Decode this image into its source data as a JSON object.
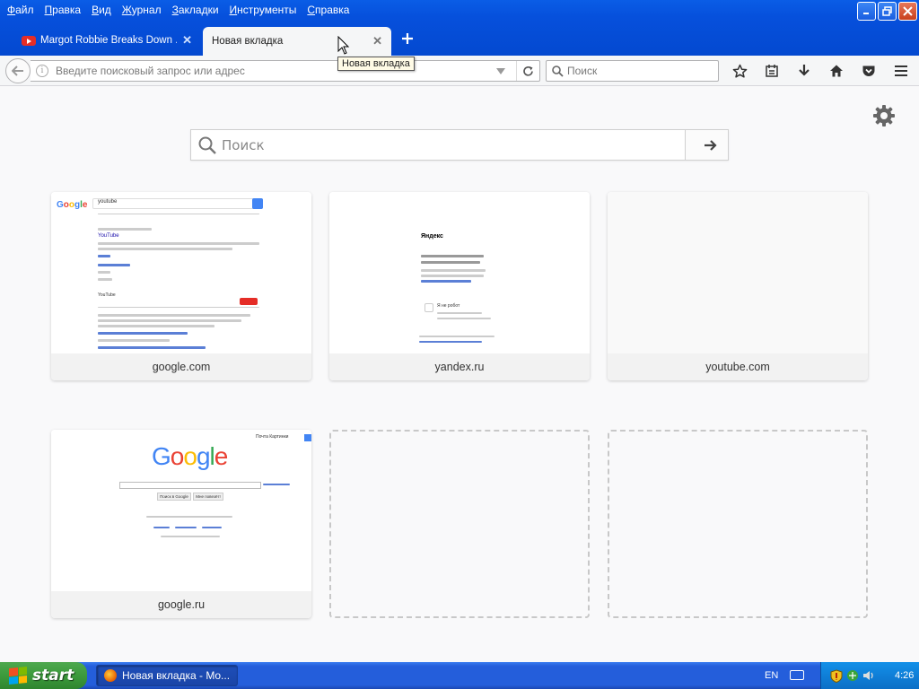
{
  "menu": {
    "items": [
      "Файл",
      "Правка",
      "Вид",
      "Журнал",
      "Закладки",
      "Инструменты",
      "Справка"
    ]
  },
  "window_controls": {
    "minimize": "minimize-icon",
    "maximize": "restore-icon",
    "close": "close-icon"
  },
  "tabs": [
    {
      "label": "Margot Robbie Breaks Down ...",
      "icon": "youtube-icon",
      "active": false
    },
    {
      "label": "Новая вкладка",
      "icon": "",
      "active": true
    }
  ],
  "tooltip": "Новая вкладка",
  "urlbar": {
    "placeholder": "Введите поисковый запрос или адрес"
  },
  "searchbar": {
    "placeholder": "Поиск"
  },
  "page_search": {
    "placeholder": "Поиск"
  },
  "tiles": [
    {
      "label": "google.com",
      "thumb": "google-results"
    },
    {
      "label": "yandex.ru",
      "thumb": "yandex-captcha"
    },
    {
      "label": "youtube.com",
      "thumb": "blank"
    },
    {
      "label": "google.ru",
      "thumb": "google-home"
    },
    {
      "label": "",
      "thumb": "empty"
    },
    {
      "label": "",
      "thumb": "empty"
    }
  ],
  "thumbs": {
    "google_results": {
      "query": "youtube",
      "result_title": "YouTube",
      "result2": "YouTube"
    },
    "yandex": {
      "logo": "Яндекс",
      "not_robot": "Я не робот"
    },
    "google_home": {
      "logo": "Google",
      "btn1": "Поиск в Google",
      "btn2": "Мне повезёт!",
      "top_links": "Почта  Картинки"
    }
  },
  "taskbar": {
    "start": "start",
    "task_label": "Новая вкладка - Mo...",
    "lang": "EN",
    "clock": "4:26"
  },
  "colors": {
    "xp_blue": "#0650dc",
    "toolbar_bg": "#f5f6f7",
    "content_bg": "#f9f9fa",
    "tray_blue": "#0f7fd8",
    "start_green": "#3c9a3c"
  }
}
